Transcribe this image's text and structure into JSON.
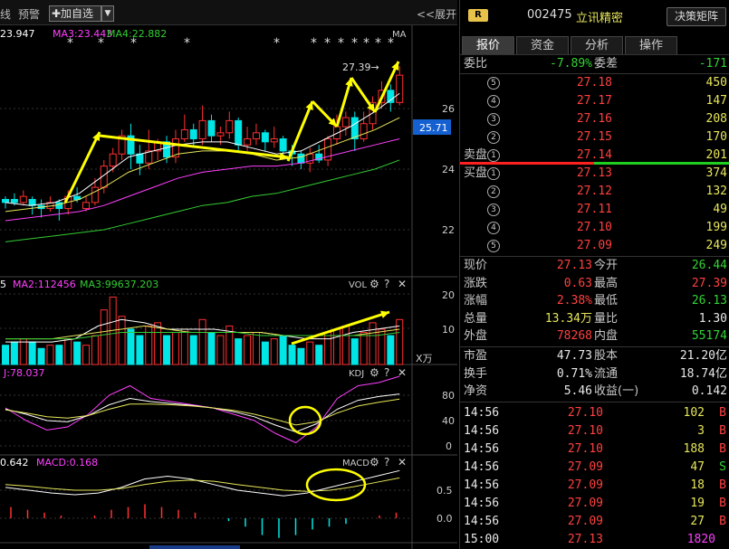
{
  "toolbar": {
    "left_label": "线",
    "alert_label": "预警",
    "add_label": "✚加自选",
    "expand_label": "<<展开"
  },
  "kline": {
    "ma_labels": [
      "23.947",
      "MA3:23.443",
      "MA4:22.882"
    ],
    "ma_tag": "MA",
    "high_marker": "27.39→",
    "price_ticks": [
      "26",
      "24",
      "22"
    ],
    "current_price_label": "25.71",
    "star_marker": "*"
  },
  "vol": {
    "labels": [
      "5",
      "MA2:112456",
      "MA3:99637.203"
    ],
    "title": "VOL",
    "ticks": [
      "20",
      "10"
    ],
    "unit": "X万"
  },
  "kdj": {
    "label": "J:78.037",
    "title": "KDJ",
    "ticks": [
      "80",
      "40",
      "0"
    ]
  },
  "macd": {
    "labels": [
      "0.642",
      "MACD:0.168"
    ],
    "title": "MACD",
    "ticks": [
      "0.5",
      "0.0"
    ]
  },
  "header": {
    "badge": "R",
    "code": "002475",
    "name": "立讯精密",
    "matrix_button": "决策矩阵"
  },
  "tabs": [
    "报价",
    "资金",
    "分析",
    "操作"
  ],
  "weibi": {
    "label1": "委比",
    "value1": "-7.89%",
    "label2": "委差",
    "value2": "-171"
  },
  "sell": [
    {
      "lvl": "5",
      "price": "27.18",
      "vol": "450"
    },
    {
      "lvl": "4",
      "price": "27.17",
      "vol": "147"
    },
    {
      "lvl": "3",
      "price": "27.16",
      "vol": "208"
    },
    {
      "lvl": "2",
      "price": "27.15",
      "vol": "170"
    },
    {
      "lvl": "1",
      "price": "27.14",
      "vol": "201"
    }
  ],
  "sell_label": "卖盘",
  "buy_label": "买盘",
  "buy": [
    {
      "lvl": "1",
      "price": "27.13",
      "vol": "374"
    },
    {
      "lvl": "2",
      "price": "27.12",
      "vol": "132"
    },
    {
      "lvl": "3",
      "price": "27.11",
      "vol": "49"
    },
    {
      "lvl": "4",
      "price": "27.10",
      "vol": "199"
    },
    {
      "lvl": "5",
      "price": "27.09",
      "vol": "249"
    }
  ],
  "stats": [
    {
      "l": "现价",
      "lv": "27.13",
      "lc": "red",
      "r": "今开",
      "rv": "26.44",
      "rc": "green"
    },
    {
      "l": "涨跌",
      "lv": "0.63",
      "lc": "red",
      "r": "最高",
      "rv": "27.39",
      "rc": "red"
    },
    {
      "l": "涨幅",
      "lv": "2.38%",
      "lc": "red",
      "r": "最低",
      "rv": "26.13",
      "rc": "green"
    },
    {
      "l": "总量",
      "lv": "13.34万",
      "lc": "yellow",
      "r": "量比",
      "rv": "1.30",
      "rc": "white"
    },
    {
      "l": "外盘",
      "lv": "78268",
      "lc": "red",
      "r": "内盘",
      "rv": "55174",
      "rc": "green"
    }
  ],
  "stats2": [
    {
      "l": "市盈",
      "lv": "47.73",
      "r": "股本",
      "rv": "21.20亿"
    },
    {
      "l": "换手",
      "lv": "0.71%",
      "r": "流通",
      "rv": "18.74亿"
    },
    {
      "l": "净资",
      "lv": "5.46",
      "r": "收益(一)",
      "rv": "0.142"
    }
  ],
  "ticks": [
    {
      "t": "14:56",
      "p": "27.10",
      "v": "102",
      "s": "B",
      "pc": "red",
      "sc": "red"
    },
    {
      "t": "14:56",
      "p": "27.10",
      "v": "3",
      "s": "B",
      "pc": "red",
      "sc": "red"
    },
    {
      "t": "14:56",
      "p": "27.10",
      "v": "188",
      "s": "B",
      "pc": "red",
      "sc": "red"
    },
    {
      "t": "14:56",
      "p": "27.09",
      "v": "47",
      "s": "S",
      "pc": "red",
      "sc": "green"
    },
    {
      "t": "14:56",
      "p": "27.09",
      "v": "18",
      "s": "B",
      "pc": "red",
      "sc": "red"
    },
    {
      "t": "14:56",
      "p": "27.09",
      "v": "19",
      "s": "B",
      "pc": "red",
      "sc": "red"
    },
    {
      "t": "14:56",
      "p": "27.09",
      "v": "27",
      "s": "B",
      "pc": "red",
      "sc": "red"
    },
    {
      "t": "15:00",
      "p": "27.13",
      "v": "1820",
      "s": "",
      "pc": "red",
      "sc": "red"
    }
  ],
  "colors": {
    "up": "#ff3030",
    "down": "#00e5e5",
    "ma1": "#ffffff",
    "ma2": "#e6e65a",
    "ma3": "#ff40ff",
    "ma4": "#33cc33",
    "arrow": "#ffff00"
  }
}
